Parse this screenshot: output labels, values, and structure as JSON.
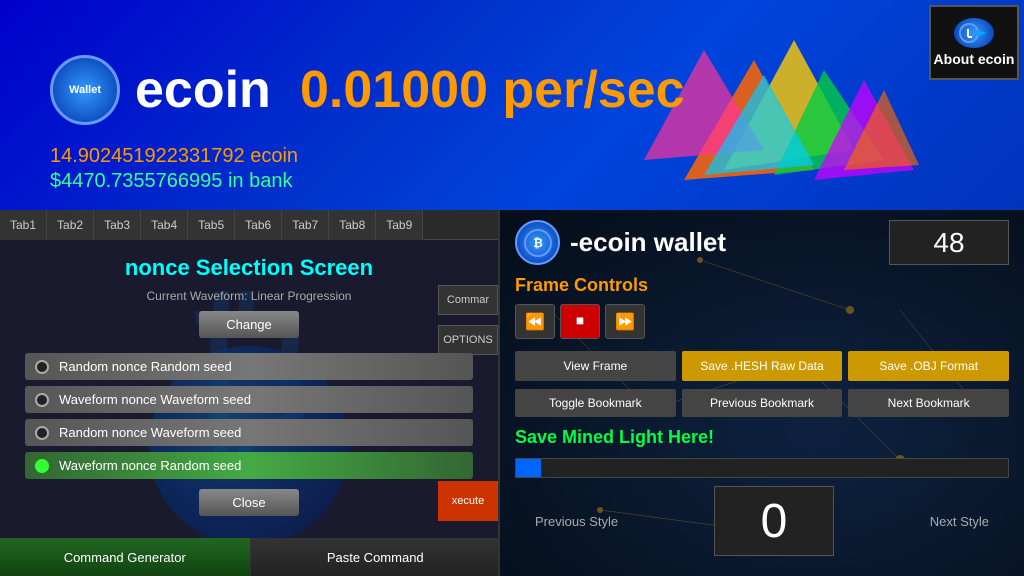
{
  "header": {
    "wallet_label": "Wallet",
    "ecoin_title": "ecoin",
    "rate": "0.01000 per/sec",
    "balance_ecoin": "14.902451922331792 ecoin",
    "balance_bank": "$4470.7355766995 in bank",
    "about_btn": "About ecoin"
  },
  "tabs": {
    "items": [
      {
        "label": "Tab1"
      },
      {
        "label": "Tab2"
      },
      {
        "label": "Tab3"
      },
      {
        "label": "Tab4"
      },
      {
        "label": "Tab5"
      },
      {
        "label": "Tab6"
      },
      {
        "label": "Tab7"
      },
      {
        "label": "Tab8"
      },
      {
        "label": "Tab9"
      }
    ]
  },
  "nonce_screen": {
    "title": "nonce Selection Screen",
    "current_waveform": "Current Waveform: Linear Progression",
    "change_btn": "Change",
    "options": [
      {
        "label": "Random nonce Random seed",
        "selected": false
      },
      {
        "label": "Waveform nonce Waveform seed",
        "selected": false
      },
      {
        "label": "Random nonce Waveform seed",
        "selected": false
      },
      {
        "label": "Waveform nonce Random seed",
        "selected": true
      }
    ],
    "close_btn": "Close",
    "commar_btn": "Commar",
    "options_btn": "OPTIONS",
    "execute_btn": "xecute"
  },
  "bottom_toolbar": {
    "cmd_gen": "Command Generator",
    "paste_cmd": "Paste Command"
  },
  "right_panel": {
    "wallet_title": "-ecoin wallet",
    "frame_number": "48",
    "frame_controls_label": "Frame Controls",
    "buttons": {
      "view_frame": "View Frame",
      "save_hesh": "Save .HESH Raw Data",
      "save_obj": "Save .OBJ Format",
      "toggle_bookmark": "Toggle Bookmark",
      "prev_bookmark": "Previous Bookmark",
      "next_bookmark": "Next Bookmark"
    },
    "save_mined": "Save Mined Light Here!",
    "frame_count": "0",
    "prev_style": "Previous Style",
    "next_style": "Next Style"
  }
}
